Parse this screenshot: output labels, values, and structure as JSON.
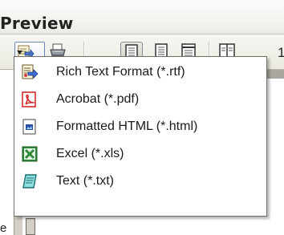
{
  "window": {
    "title": "Preview"
  },
  "toolbar": {
    "zoom_partial": "1",
    "buttons": [
      {
        "name": "export-icon"
      },
      {
        "name": "printer-icon"
      },
      {
        "name": "single-page-icon"
      },
      {
        "name": "two-page-icon"
      },
      {
        "name": "multi-page-icon"
      },
      {
        "name": "side-by-side-icon"
      }
    ]
  },
  "export_menu": {
    "items": [
      {
        "label": "Rich Text Format (*.rtf)",
        "icon": "rtf-document-icon"
      },
      {
        "label": "Acrobat (*.pdf)",
        "icon": "pdf-icon"
      },
      {
        "label": "Formatted HTML (*.html)",
        "icon": "html-document-icon"
      },
      {
        "label": "Excel (*.xls)",
        "icon": "excel-icon"
      },
      {
        "label": "Text (*.txt)",
        "icon": "text-file-icon"
      }
    ]
  },
  "background": {
    "partial_text": "e"
  },
  "colors": {
    "menu_border": "#6f6d66",
    "pdf_red": "#d42a2a",
    "excel_green": "#2f8a3b",
    "text_teal": "#2aa7a7",
    "html_blue": "#2a4fa8"
  }
}
